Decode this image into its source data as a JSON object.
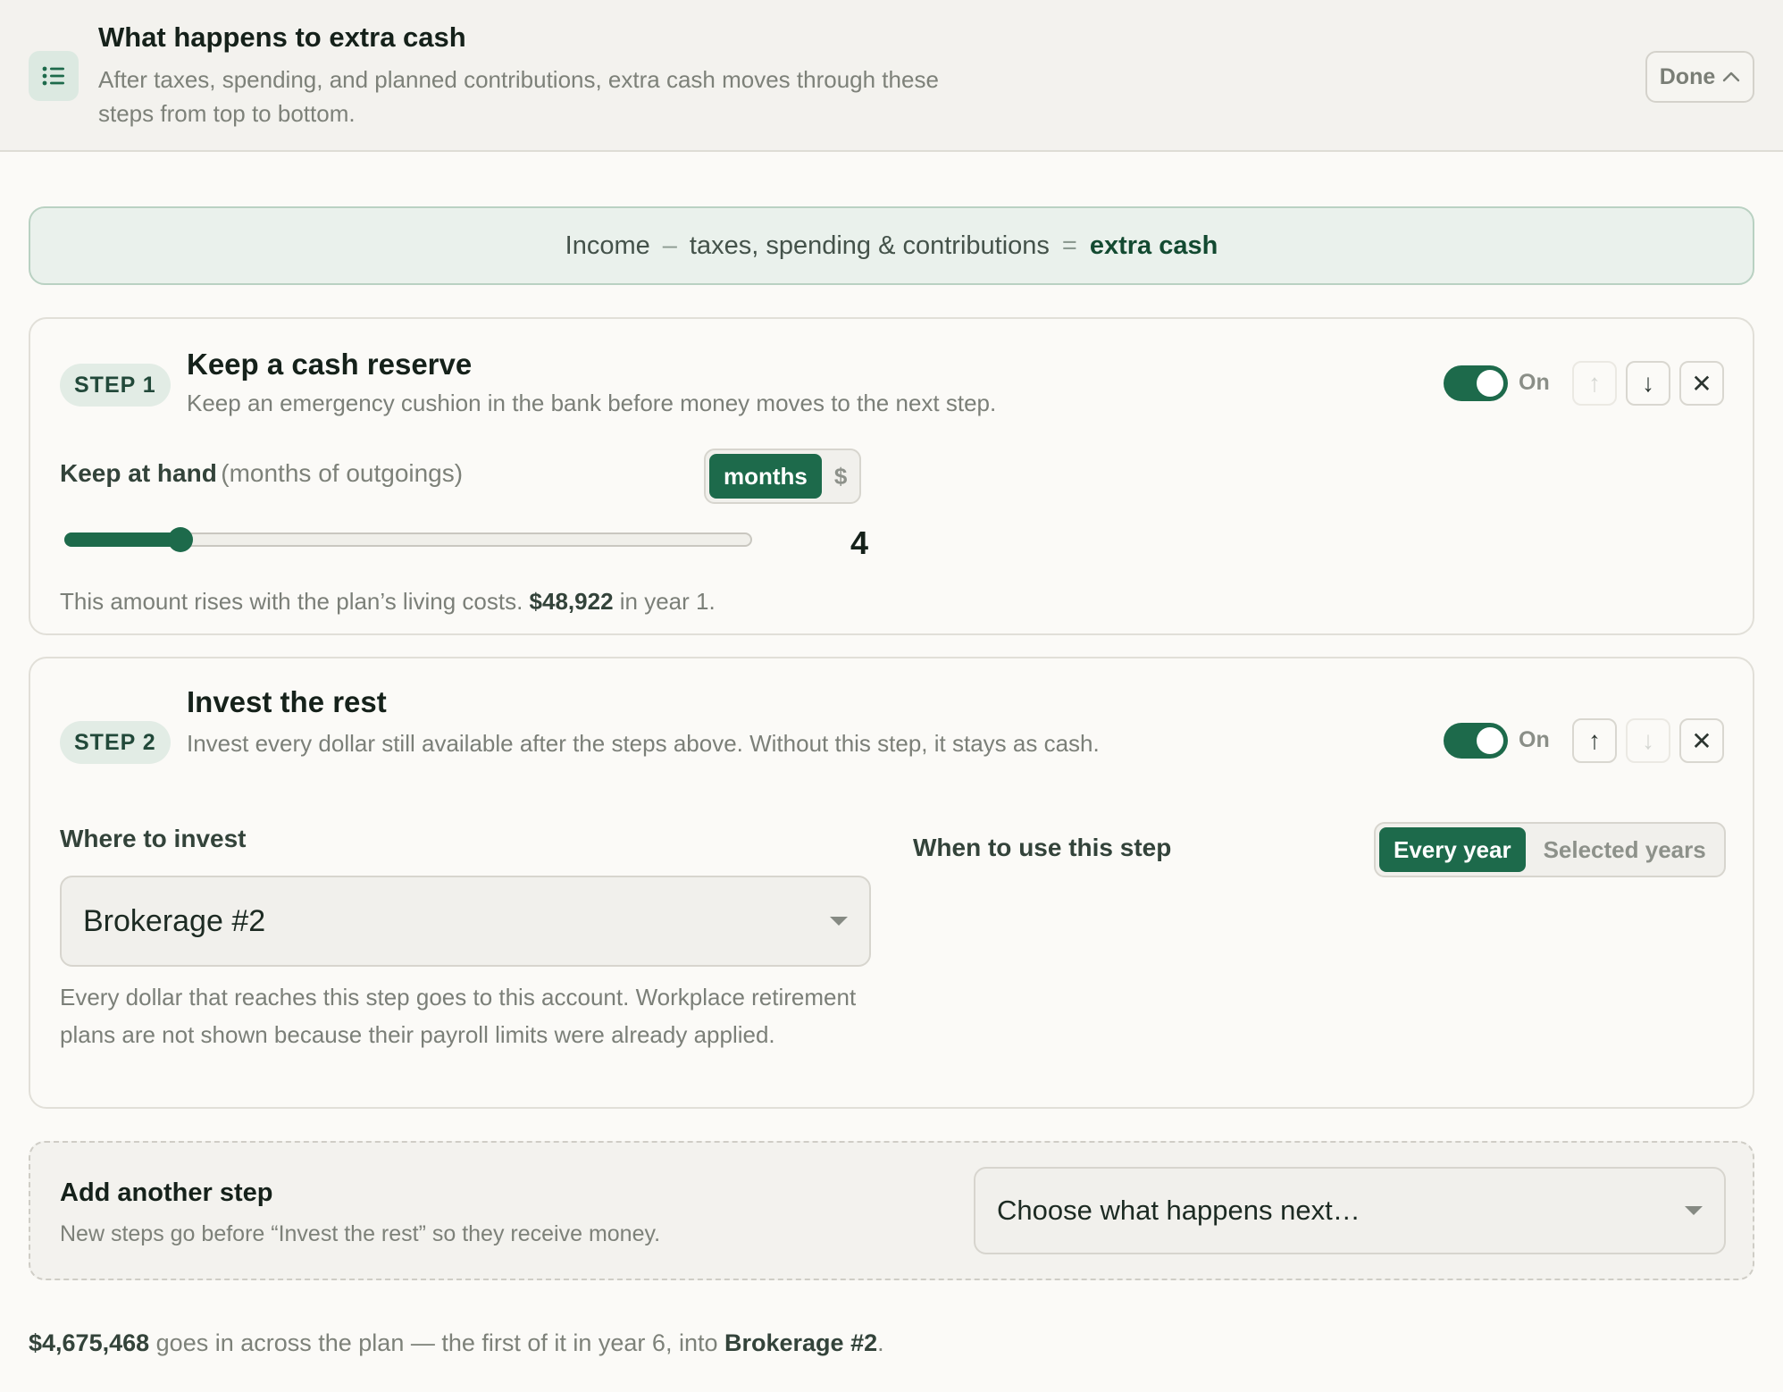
{
  "header": {
    "title": "What happens to extra cash",
    "description": "After taxes, spending, and planned contributions, extra cash moves through these steps from top to bottom.",
    "icon": "list-icon",
    "done_label": "Done"
  },
  "formula": {
    "income": "Income",
    "minus": "–",
    "deductions": "taxes, spending & contributions",
    "equals": "=",
    "result": "extra cash"
  },
  "steps": [
    {
      "pill": "STEP 1",
      "title": "Keep a cash reserve",
      "description": "Keep an emergency cushion in the bank before money moves to the next step.",
      "toggle_label": "On",
      "toggle_on": true,
      "keep_label": "Keep at hand",
      "keep_unit": "(months of outgoings)",
      "unit_options": [
        "months",
        "$"
      ],
      "unit_selected": "months",
      "slider_value": "4",
      "slider_min": 0,
      "slider_max": 24,
      "note_prefix": "This amount rises with the plan’s living costs.",
      "note_amount": "$48,922",
      "note_suffix": "in year 1."
    },
    {
      "pill": "STEP 2",
      "title": "Invest the rest",
      "description": "Invest every dollar still available after the steps above. Without this step, it stays as cash.",
      "toggle_label": "On",
      "toggle_on": true,
      "where_label": "Where to invest",
      "account": "Brokerage #2",
      "account_note": "Every dollar that reaches this step goes to this account. Workplace retirement plans are not shown because their payroll limits were already applied.",
      "when_label": "When to use this step",
      "when_options": [
        "Every year",
        "Selected years"
      ],
      "when_selected": "Every year"
    }
  ],
  "add_step": {
    "title": "Add another step",
    "description": "New steps go before “Invest the rest” so they receive money.",
    "select_placeholder": "Choose what happens next…"
  },
  "summary": {
    "amount": "$4,675,468",
    "middle": "goes in across the plan — the first of it in year 6, into",
    "account": "Brokerage #2",
    "end": "."
  },
  "colors": {
    "accent": "#1d6a4b",
    "banner_bg": "#eaf1ec",
    "page_bg": "#fbfaf7"
  }
}
